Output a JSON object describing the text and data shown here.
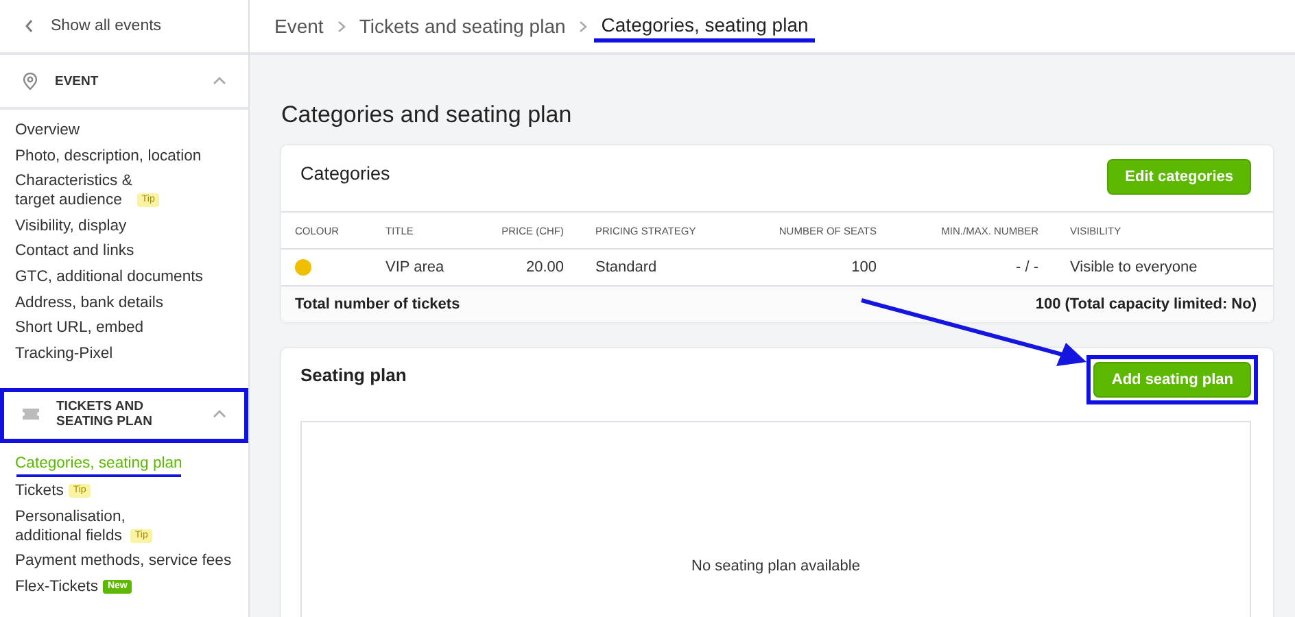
{
  "sidebar": {
    "back_link": "Show all events",
    "sections": [
      {
        "title": "EVENT",
        "expanded": true,
        "highlighted": false,
        "items": [
          {
            "label": "Overview",
            "selected": false,
            "underlined": false
          },
          {
            "label": "Photo, description, location",
            "selected": false,
            "underlined": false
          },
          {
            "label": "Characteristics &\ntarget audience",
            "badge": {
              "kind": "tip",
              "text": "Tip"
            },
            "selected": false,
            "underlined": false
          },
          {
            "label": "Visibility, display",
            "selected": false,
            "underlined": false
          },
          {
            "label": "Contact and links",
            "selected": false,
            "underlined": false
          },
          {
            "label": "GTC, additional documents",
            "selected": false,
            "underlined": false
          },
          {
            "label": "Address, bank details",
            "selected": false,
            "underlined": false
          },
          {
            "label": "Short URL, embed",
            "selected": false,
            "underlined": false
          },
          {
            "label": "Tracking-Pixel",
            "selected": false,
            "underlined": false
          }
        ]
      },
      {
        "title": "TICKETS AND SEATING PLAN",
        "expanded": true,
        "highlighted": true,
        "items": [
          {
            "label": "Categories, seating plan",
            "selected": true,
            "underlined": true
          },
          {
            "label": "Tickets",
            "badge": {
              "kind": "tip",
              "text": "Tip"
            },
            "selected": false,
            "underlined": false
          },
          {
            "label": "Personalisation,\nadditional fields",
            "badge": {
              "kind": "tip",
              "text": "Tip"
            },
            "selected": false,
            "underlined": false
          },
          {
            "label": "Payment methods, service fees",
            "selected": false,
            "underlined": false
          },
          {
            "label": "Flex-Tickets",
            "badge": {
              "kind": "new",
              "text": "New"
            },
            "selected": false,
            "underlined": false
          }
        ]
      }
    ]
  },
  "breadcrumb": [
    {
      "label": "Event",
      "current": false,
      "underlined": false
    },
    {
      "label": "Tickets and seating plan",
      "current": false,
      "underlined": false
    },
    {
      "label": "Categories, seating plan",
      "current": true,
      "underlined": true
    }
  ],
  "page_title": "Categories and seating plan",
  "categories": {
    "title": "Categories",
    "button": "Edit categories",
    "columns": [
      "COLOUR",
      "TITLE",
      "PRICE (CHF)",
      "PRICING STRATEGY",
      "NUMBER OF SEATS",
      "MIN./MAX. NUMBER",
      "VISIBILITY"
    ],
    "rows": [
      {
        "color": "#f0c000",
        "title": "VIP area",
        "price": "20.00",
        "pricing_strategy": "Standard",
        "seats": "100",
        "min_max": "- / -",
        "visibility": "Visible to everyone"
      }
    ],
    "total_label": "Total number of tickets",
    "total_value": "100 (Total capacity limited: No)"
  },
  "seating_plan": {
    "title": "Seating plan",
    "button": "Add seating plan",
    "button_highlighted": true,
    "empty_text": "No seating plan available"
  },
  "annotation_arrow": true
}
